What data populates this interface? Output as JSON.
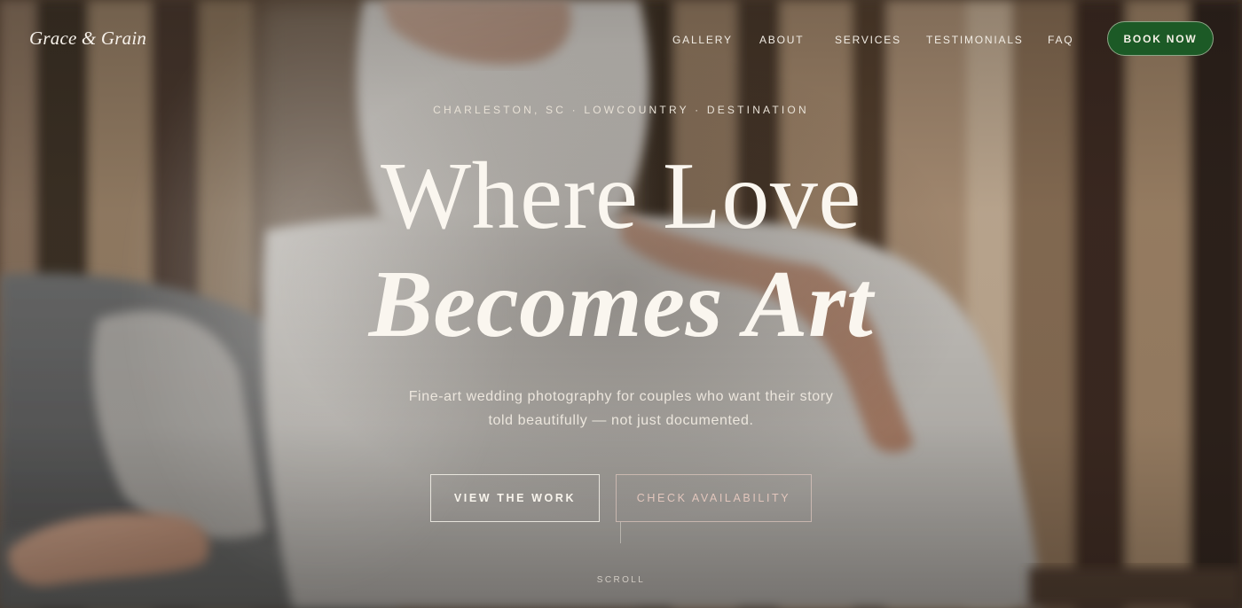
{
  "nav": {
    "brand": "Grace & Grain",
    "links": [
      "GALLERY",
      "ABOUT",
      "SERVICES",
      "TESTIMONIALS",
      "FAQ"
    ],
    "cta": "BOOK NOW"
  },
  "hero": {
    "eyebrow": "CHARLESTON, SC · LOWCOUNTRY · DESTINATION",
    "headline_line1": "Where Love",
    "headline_line2": "Becomes Art",
    "subtitle": "Fine-art wedding photography for couples who want their story told beautifully — not just documented.",
    "primary_button": "VIEW THE WORK",
    "secondary_button": "CHECK AVAILABILITY",
    "scroll_label": "SCROLL"
  },
  "colors": {
    "cta_background": "#1c5a26",
    "text_cream": "#faf6ef",
    "secondary_button_text": "#e2c6bc"
  },
  "background_image": "wedding-bride-photo"
}
